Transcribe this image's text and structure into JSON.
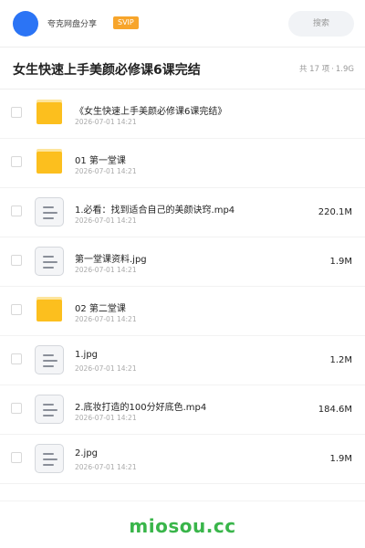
{
  "header": {
    "brand": "夸克网盘分享",
    "badge": "SVIP",
    "search_label": "搜索"
  },
  "title_row": {
    "title": "女生快速上手美颜必修课6课完结",
    "count": "共 17 项",
    "separator": "·",
    "total_size": "1.9G"
  },
  "items": [
    {
      "type": "folder",
      "name": "《女生快速上手美颜必修课6课完结》",
      "date": "2026-07-01 14:21",
      "size": ""
    },
    {
      "type": "folder",
      "name": "01 第一堂课",
      "date": "2026-07-01 14:21",
      "size": ""
    },
    {
      "type": "file",
      "name": "1.必看：找到适合自己的美颜诀窍.mp4",
      "date": "2026-07-01 14:21",
      "size": "220.1M"
    },
    {
      "type": "file",
      "name": "第一堂课资料.jpg",
      "date": "2026-07-01 14:21",
      "size": "1.9M"
    },
    {
      "type": "folder",
      "name": "02 第二堂课",
      "date": "2026-07-01 14:21",
      "size": ""
    },
    {
      "type": "file",
      "name": "1.jpg",
      "date": "2026-07-01 14:21",
      "size": "1.2M"
    },
    {
      "type": "file",
      "name": "2.底妆打造的100分好底色.mp4",
      "date": "2026-07-01 14:21",
      "size": "184.6M"
    },
    {
      "type": "file",
      "name": "2.jpg",
      "date": "2026-07-01 14:21",
      "size": "1.9M"
    }
  ],
  "icons": {
    "folder": "folder-icon",
    "file": "document-icon"
  },
  "colors": {
    "accent": "#2b74f5",
    "badge": "#f7a52b",
    "folder": "#fcbf1e",
    "watermark": "#39b54a"
  },
  "footer": {
    "watermark": "miosou.cc"
  }
}
